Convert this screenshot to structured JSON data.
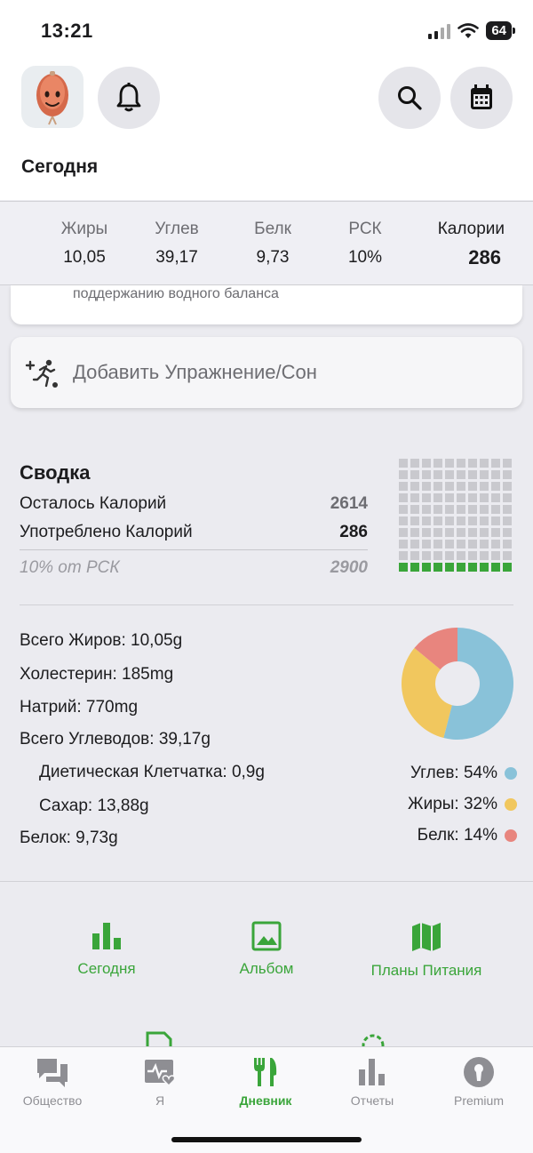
{
  "status": {
    "time": "13:21",
    "battery": "64"
  },
  "header": {
    "title": "Сегодня"
  },
  "macros": [
    {
      "label": "Жиры",
      "value": "10,05"
    },
    {
      "label": "Углев",
      "value": "39,17"
    },
    {
      "label": "Белк",
      "value": "9,73"
    },
    {
      "label": "РСК",
      "value": "10%"
    },
    {
      "label": "Калории",
      "value": "286"
    }
  ],
  "partial_card": {
    "text": "поддержанию водного баланса"
  },
  "add_exercise": {
    "label": "Добавить Упражнение/Сон"
  },
  "summary": {
    "title": "Сводка",
    "remaining_label": "Осталось Калорий",
    "remaining_value": "2614",
    "consumed_label": "Употреблено Калорий",
    "consumed_value": "286",
    "percent_label": "10% от РСК",
    "target_value": "2900",
    "grid_fraction": 0.1
  },
  "nutrients": {
    "fat": "Всего Жиров: 10,05g",
    "cholesterol": "Холестерин: 185mg",
    "sodium": "Натрий: 770mg",
    "carbs": "Всего Углеводов: 39,17g",
    "fiber": "Диетическая Клетчатка: 0,9g",
    "sugar": "Сахар: 13,88g",
    "protein": "Белок: 9,73g"
  },
  "chart_data": {
    "type": "pie",
    "categories": [
      "Углев",
      "Жиры",
      "Белк"
    ],
    "values": [
      54,
      32,
      14
    ],
    "colors": [
      "#89c2d9",
      "#f1c75e",
      "#e8857e"
    ],
    "legend_labels": [
      "Углев: 54%",
      "Жиры: 32%",
      "Белк: 14%"
    ]
  },
  "quick_actions": [
    {
      "label": "Сегодня",
      "icon": "bar-chart-icon"
    },
    {
      "label": "Альбом",
      "icon": "image-icon"
    },
    {
      "label": "Планы Питания",
      "icon": "map-icon"
    }
  ],
  "tabs": [
    {
      "label": "Общество",
      "icon": "chat-icon"
    },
    {
      "label": "Я",
      "icon": "health-icon"
    },
    {
      "label": "Дневник",
      "icon": "fork-knife-icon"
    },
    {
      "label": "Отчеты",
      "icon": "bar-chart-icon"
    },
    {
      "label": "Premium",
      "icon": "premium-icon"
    }
  ],
  "colors": {
    "accent": "#3aa53a"
  }
}
